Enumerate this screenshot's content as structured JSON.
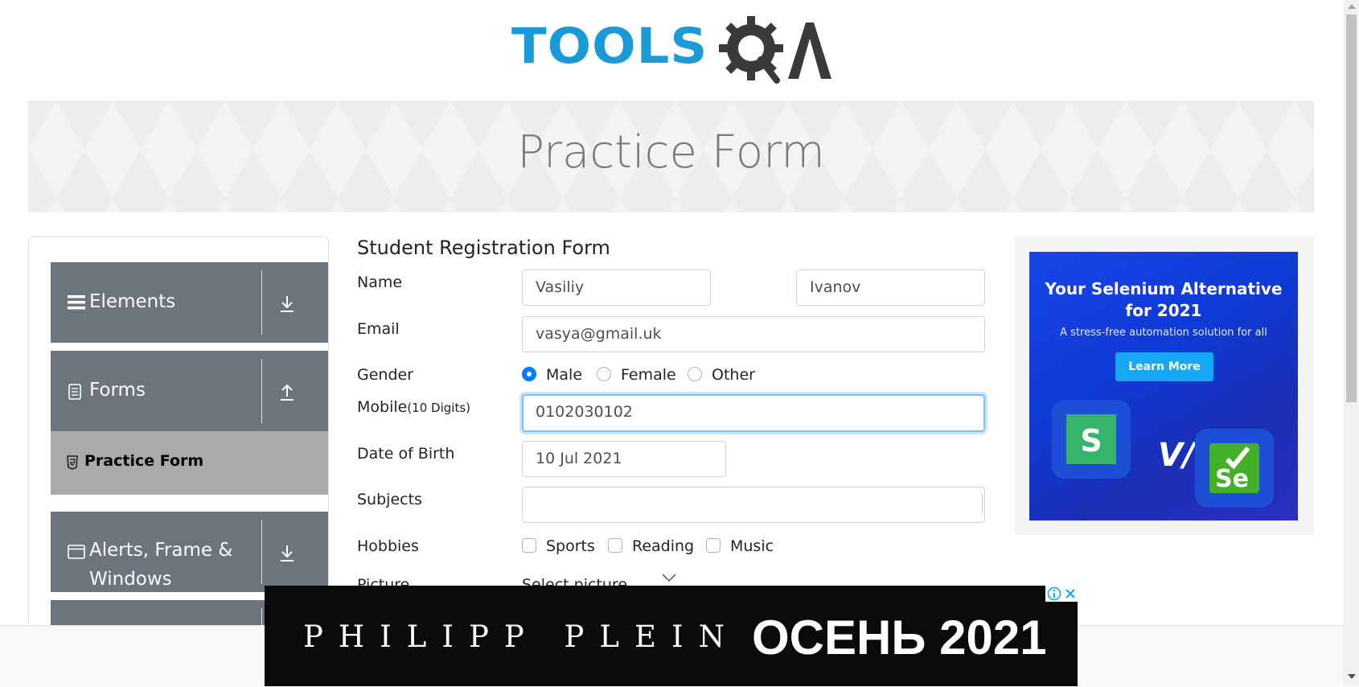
{
  "header": {
    "logo_text": "TOOLS",
    "logo_suffix": "QA"
  },
  "banner": {
    "title": "Practice Form"
  },
  "sidebar": {
    "groups": [
      {
        "title": "Elements",
        "icon": "hamburger-icon",
        "arrow": "download-arrow-icon"
      },
      {
        "title": "Forms",
        "icon": "document-icon",
        "arrow": "upload-arrow-icon"
      },
      {
        "title": "Alerts, Frame &",
        "title_line2": "Windows",
        "icon": "window-icon",
        "arrow": "download-arrow-icon"
      }
    ],
    "active_item": {
      "label": "Practice Form",
      "icon": "html5-icon"
    }
  },
  "form": {
    "title": "Student Registration Form",
    "name_label": "Name",
    "first_name": "Vasiliy",
    "last_name": "Ivanov",
    "email_label": "Email",
    "email": "vasya@gmail.uk",
    "gender_label": "Gender",
    "genders": [
      "Male",
      "Female",
      "Other"
    ],
    "gender_selected": "Male",
    "mobile_label": "Mobile",
    "mobile_hint": "(10 Digits)",
    "mobile": "0102030102",
    "dob_label": "Date of Birth",
    "dob": "10 Jul 2021",
    "subjects_label": "Subjects",
    "subjects": "",
    "hobbies_label": "Hobbies",
    "hobbies": [
      "Sports",
      "Reading",
      "Music"
    ],
    "picture_label": "Picture",
    "picture_placeholder": "Select picture"
  },
  "ad_side": {
    "headline_1": "Your Selenium Alternative",
    "headline_2": "for 2021",
    "subtitle": "A stress-free automation solution for all",
    "button": "Learn More",
    "vs": "V/s",
    "logo_left": "S",
    "logo_right": "Se"
  },
  "ad_bottom": {
    "brand": "PHILIPP PLEIN",
    "season": "ОСЕНЬ 2021"
  },
  "colors": {
    "accent": "#007bff",
    "logo_blue": "#1b9ad8",
    "sidebar_bg": "#6c757d",
    "active_bg": "#aaaaaa"
  }
}
